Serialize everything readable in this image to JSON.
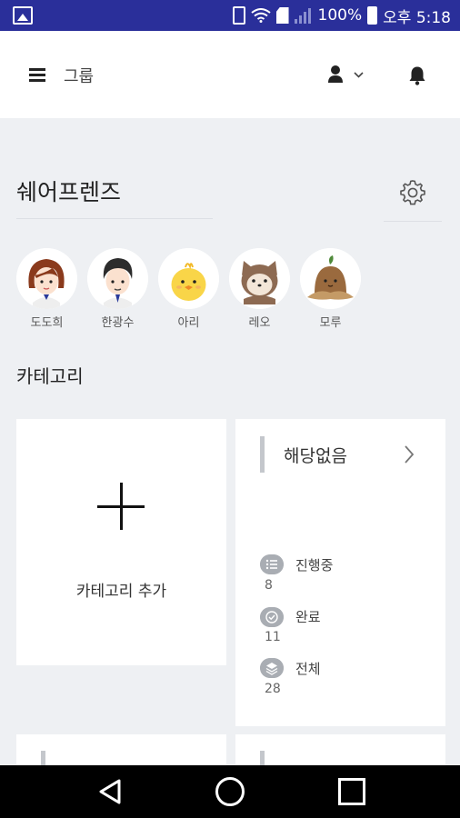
{
  "status_bar": {
    "battery_percent": "100%",
    "time": "오후 5:18",
    "icons": [
      "image-icon",
      "vibrate-icon",
      "wifi-icon",
      "sim-icon",
      "signal-icon",
      "battery-icon"
    ]
  },
  "header": {
    "title": "그룹",
    "menu_icon": "hamburger-icon",
    "user_icon": "user-dropdown-icon",
    "bell_icon": "bell-icon"
  },
  "group": {
    "name": "쉐어프렌즈",
    "settings_icon": "gear-icon"
  },
  "friends": [
    {
      "name": "도도희",
      "avatar": "woman-avatar"
    },
    {
      "name": "한광수",
      "avatar": "man-avatar"
    },
    {
      "name": "아리",
      "avatar": "chick-avatar"
    },
    {
      "name": "레오",
      "avatar": "raccoon-avatar"
    },
    {
      "name": "모루",
      "avatar": "mole-avatar"
    }
  ],
  "categories": {
    "section_title": "카테고리",
    "add_label": "카테고리 추가",
    "card": {
      "name": "해당없음",
      "stats": [
        {
          "label": "진행중",
          "value": "8",
          "icon": "list-icon"
        },
        {
          "label": "완료",
          "value": "11",
          "icon": "check-icon"
        },
        {
          "label": "전체",
          "value": "28",
          "icon": "layers-icon"
        }
      ]
    }
  },
  "colors": {
    "status_bar": "#2a2f9a",
    "background": "#eef0f3",
    "card": "#ffffff"
  }
}
